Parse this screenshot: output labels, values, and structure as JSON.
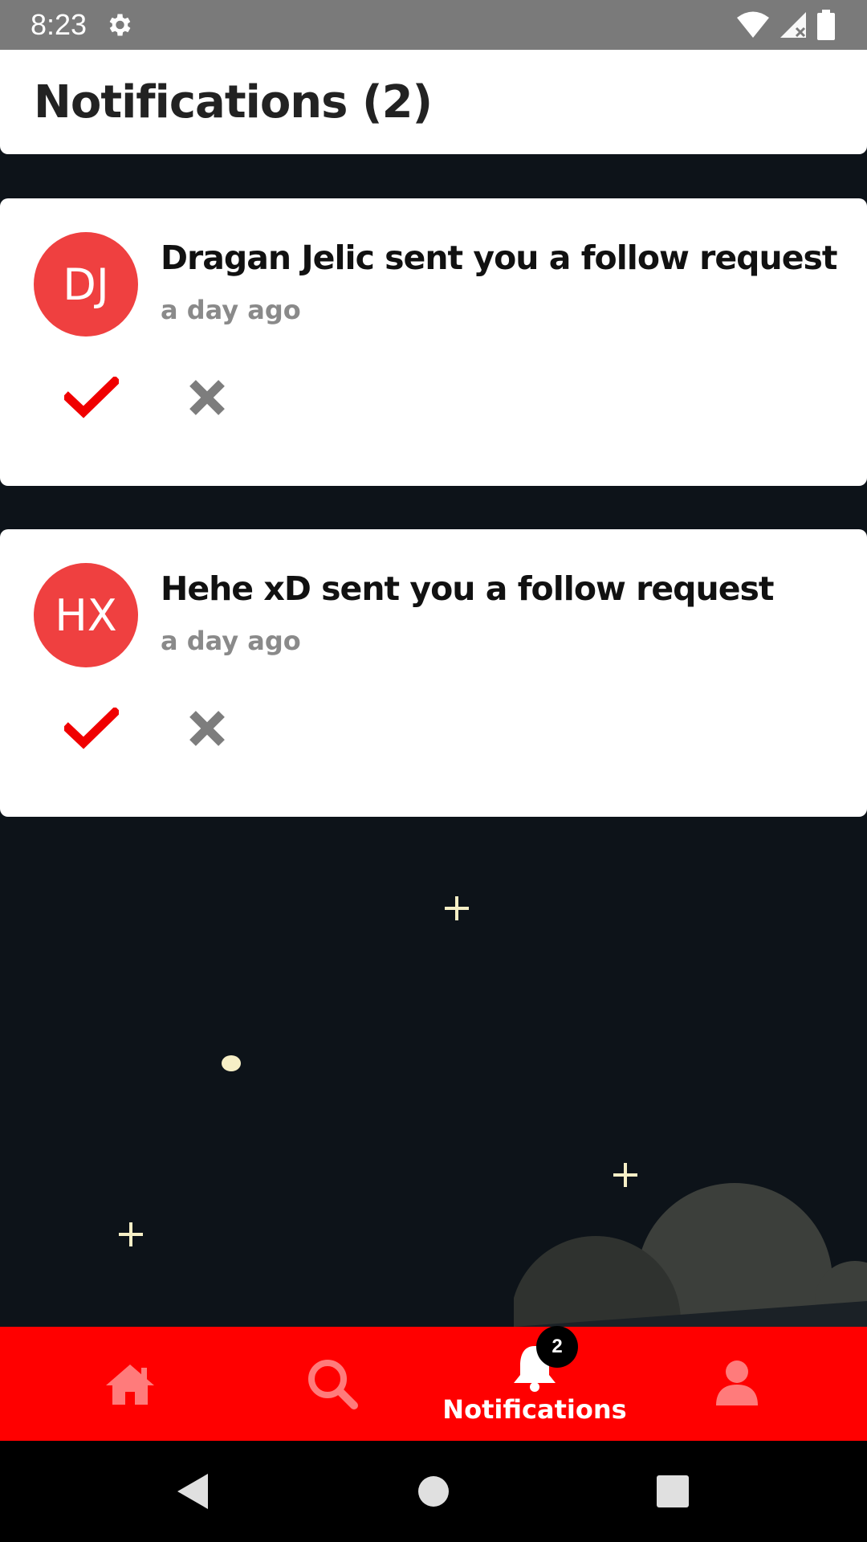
{
  "status_bar": {
    "time": "8:23",
    "icons": [
      "settings-gear-icon",
      "wifi-icon",
      "cellular-no-signal-icon",
      "battery-icon"
    ]
  },
  "header": {
    "title": "Notifications (2)"
  },
  "notifications": [
    {
      "avatar_initials": "DJ",
      "avatar_color": "#ef4040",
      "message": "Dragan Jelic sent you a follow request",
      "time": "a day ago",
      "accept_icon": "check-icon",
      "reject_icon": "x-icon"
    },
    {
      "avatar_initials": "HX",
      "avatar_color": "#ef4040",
      "message": "Hehe xD sent you a follow request",
      "time": "a day ago",
      "accept_icon": "check-icon",
      "reject_icon": "x-icon"
    }
  ],
  "bottom_nav": {
    "items": [
      {
        "icon": "home-icon",
        "label": ""
      },
      {
        "icon": "search-icon",
        "label": ""
      },
      {
        "icon": "bell-icon",
        "label": "Notifications",
        "badge": "2"
      },
      {
        "icon": "user-icon",
        "label": ""
      }
    ],
    "active": "Notifications"
  },
  "colors": {
    "accent": "#ff0000",
    "background": "#0d1319",
    "avatar": "#ef4040",
    "inactive_icon": "#ff7b7b",
    "reject_gray": "#7d7d7d"
  }
}
